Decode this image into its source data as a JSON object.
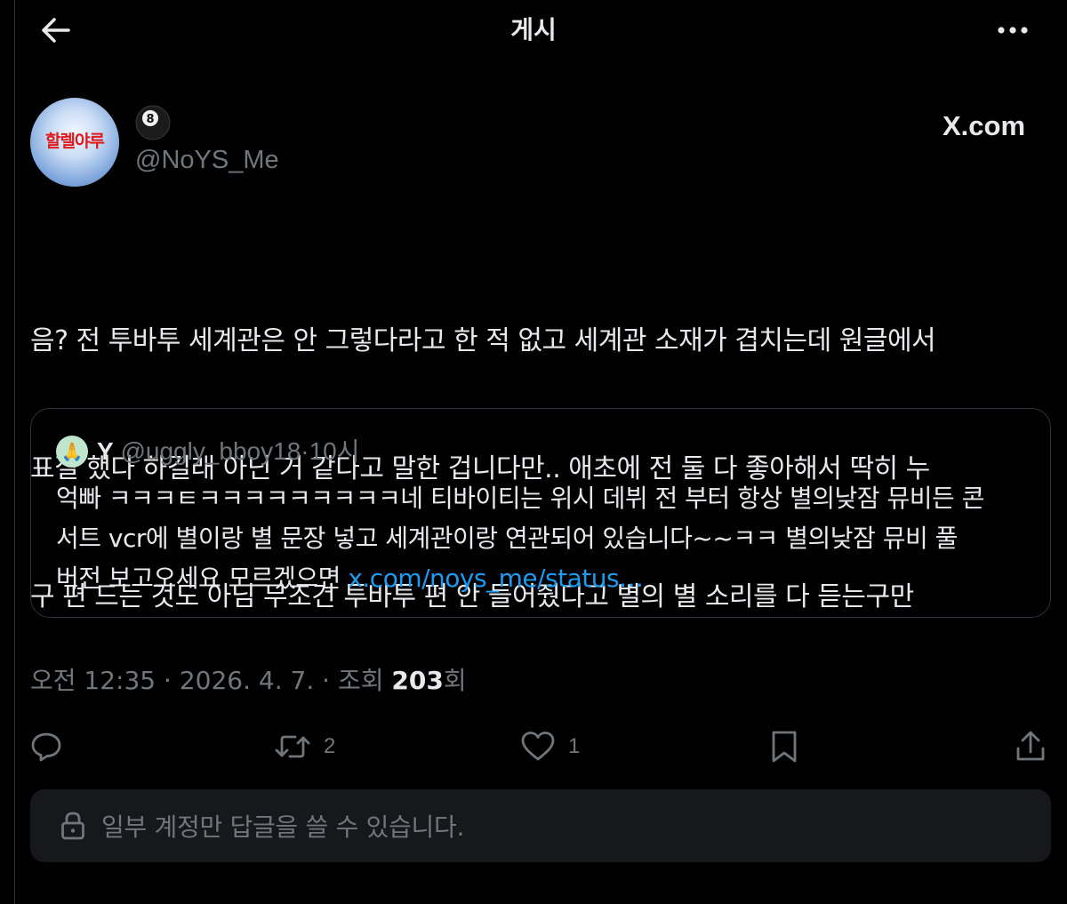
{
  "header": {
    "title": "게시",
    "back_icon": "arrow-left-icon",
    "more_icon": "more-horizontal-icon"
  },
  "author": {
    "avatar_text": "할렐야루",
    "display_name_icon": "8-ball-icon",
    "handle": "@NoYS_Me"
  },
  "watermark": "X.com",
  "post": {
    "lines": [
      "음? 전 투바투 세계관은 안 그렇다라고 한 적 없고 세계관 소재가 겹치는데 원글에서",
      "표절 했다 하길래 아닌 거 같다고 말한 겁니다만.. 애초에 전 둘 다 좋아해서 딱히 누",
      "구 편 드는 것도 아님 무조건 투바투 편 안 들어줬다고 별의 별 소리를 다 듣는구만"
    ]
  },
  "quote": {
    "avatar_emoji": "🙏",
    "name": "Y",
    "handle": "@uggly_bboy18",
    "separator": "·",
    "time": "10시",
    "lines": [
      "억빠 ㅋㅋㅋㅌㅋㅋㅋㅋㅋㅋㅋㅋㅋ네 티바이티는 위시 데뷔 전 부터 항상 별의낮잠 뮤비든 콘",
      "서트 vcr에 별이랑 별 문장 넣고 세계관이랑 연관되어 있습니다~~ㅋㅋ 별의낮잠 뮤비 풀"
    ],
    "last_line_text": "버전 보고오세요 모르겠으면 ",
    "link": "x.com/noys_me/status…"
  },
  "meta": {
    "time": "오전 12:35",
    "date": "2026. 4. 7.",
    "views_label": "조회",
    "views_count": "203",
    "views_suffix": "회",
    "separator": "·"
  },
  "actions": {
    "reply_icon": "reply-icon",
    "retweet_icon": "retweet-icon",
    "retweet_count": "2",
    "like_icon": "heart-icon",
    "like_count": "1",
    "bookmark_icon": "bookmark-icon",
    "share_icon": "share-icon"
  },
  "restricted": {
    "icon": "lock-icon",
    "text": "일부 계정만 답글을 쓸 수 있습니다."
  },
  "colors": {
    "background": "#000000",
    "text": "#e7e9ea",
    "secondary": "#71767b",
    "link": "#1d9bf0",
    "border": "#2f3336",
    "panel": "#16181c"
  }
}
